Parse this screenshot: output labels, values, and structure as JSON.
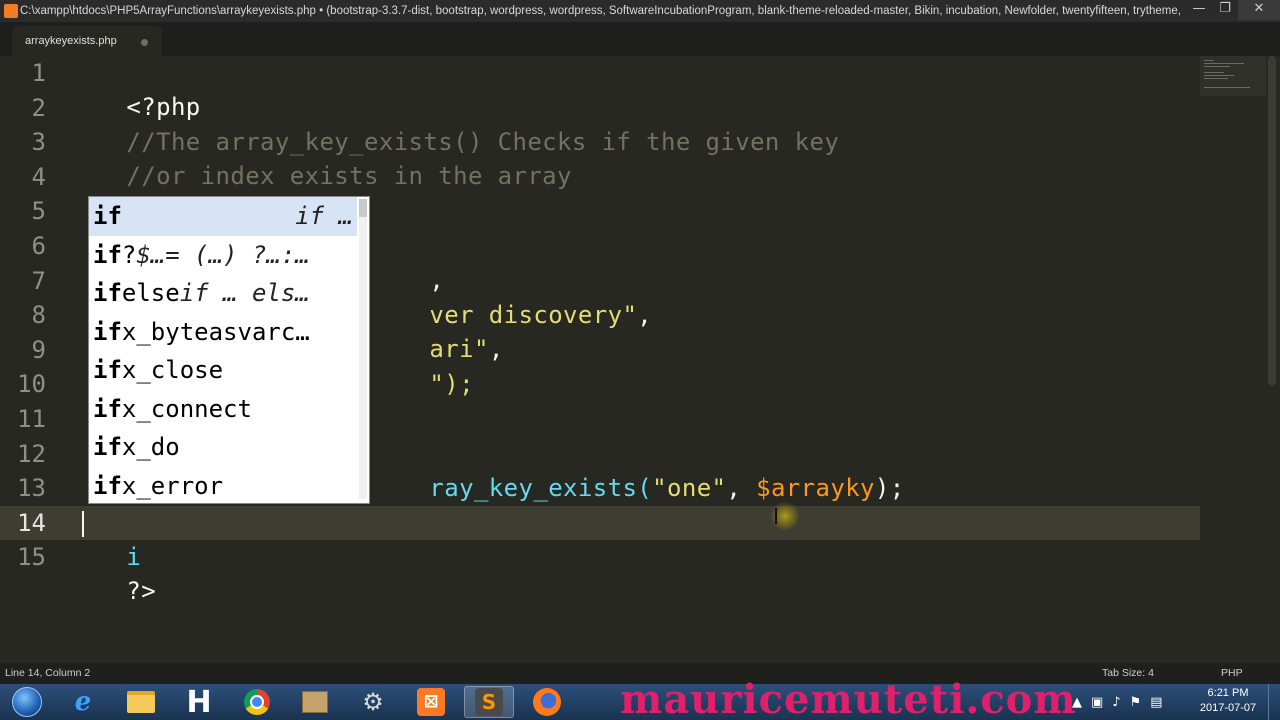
{
  "window": {
    "title": "C:\\xampp\\htdocs\\PHP5ArrayFunctions\\arraykeyexists.php • (bootstrap-3.3.7-dist, bootstrap, wordpress, wordpress, SoftwareIncubationProgram, blank-theme-reloaded-master, Bikin, incubation, Newfolder, twentyfifteen, trytheme, s...",
    "controls": {
      "minimize": "—",
      "maximize": "❐",
      "close": "✕"
    }
  },
  "tabs": [
    {
      "label": "arraykeyexists.php",
      "modified": true
    }
  ],
  "editor": {
    "line_numbers": [
      "1",
      "2",
      "3",
      "4",
      "5",
      "6",
      "7",
      "8",
      "9",
      "10",
      "11",
      "12",
      "13",
      "14",
      "15"
    ],
    "active_line": "14",
    "lines": {
      "l1": "<?php",
      "l2": "//The array_key_exists() Checks if the given key",
      "l3": "//or index exists in the array",
      "l5_a": "$",
      "l6_a": ",",
      "l7_a": "ver discovery\"",
      "l7_b": ",",
      "l8_a": "ari\"",
      "l8_b": ",",
      "l9_a": "\");",
      "l12_a": "$",
      "l12_fn": "ray_key_exists(",
      "l12_str": "\"one\"",
      "l12_comma": ", ",
      "l12_var": "$arrayky",
      "l12_end": ");",
      "l14": "i",
      "l15": "?>"
    }
  },
  "autocomplete": {
    "items": [
      {
        "match": "if",
        "rest": "",
        "hint": "if …"
      },
      {
        "match": "if",
        "rest": "?",
        "hint": "$…= (…) ?…:…"
      },
      {
        "match": "if",
        "rest": "else",
        "hint": "if … els…"
      },
      {
        "match": "if",
        "rest": "x_byteasvarc…",
        "hint": ""
      },
      {
        "match": "if",
        "rest": "x_close",
        "hint": ""
      },
      {
        "match": "if",
        "rest": "x_connect",
        "hint": ""
      },
      {
        "match": "if",
        "rest": "x_do",
        "hint": ""
      },
      {
        "match": "if",
        "rest": "x_error",
        "hint": ""
      }
    ],
    "selected_index": 0
  },
  "status_bar": {
    "position": "Line 14, Column 2",
    "tab_size": "Tab Size: 4",
    "syntax": "PHP"
  },
  "taskbar": {
    "apps": [
      "start-button",
      "internet-explorer",
      "file-explorer",
      "h-app",
      "chrome",
      "package-app",
      "tools-app",
      "xampp",
      "sublime-text",
      "firefox"
    ],
    "watermark": "mauricemuteti.com",
    "clock_time": "6:21 PM",
    "clock_date": "2017-07-07"
  },
  "colors": {
    "editor_bg": "#272822",
    "comment": "#75715e",
    "string": "#e6db74",
    "variable": "#fd971f",
    "function": "#66d9ef",
    "watermark": "#e0206a"
  }
}
